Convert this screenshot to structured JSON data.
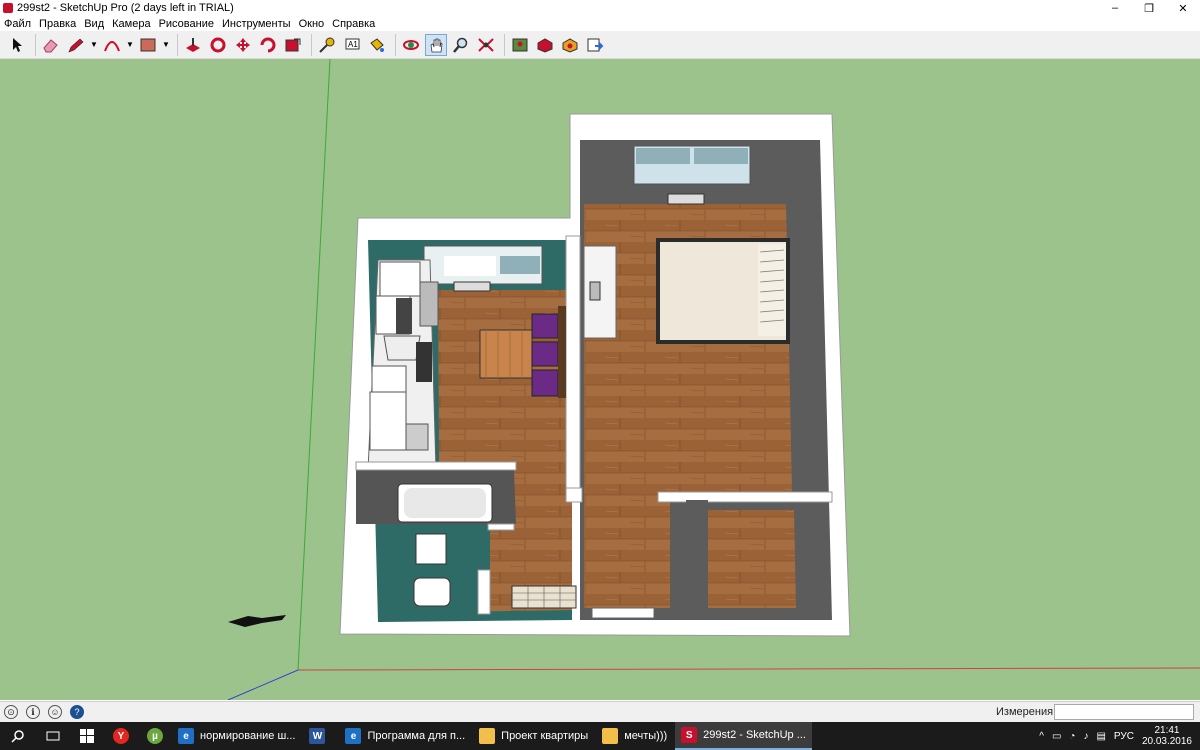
{
  "window": {
    "title": "299st2 - SketchUp Pro (2 days left in TRIAL)",
    "minimize": "–",
    "restore": "❐",
    "close": "✕"
  },
  "menu": [
    "Файл",
    "Правка",
    "Вид",
    "Камера",
    "Рисование",
    "Инструменты",
    "Окно",
    "Справка"
  ],
  "toolbar": {
    "tools": [
      "select-icon",
      "eraser-icon",
      "pencil-icon",
      "arc-icon",
      "rectangle-icon",
      "push-pull-icon",
      "follow-me-icon",
      "move-icon",
      "rotate-icon",
      "scale-icon",
      "tape-measure-icon",
      "text-icon",
      "paint-bucket-icon",
      "orbit-icon",
      "pan-icon",
      "zoom-icon",
      "zoom-extents-icon",
      "add-location-icon",
      "3d-warehouse-icon",
      "extension-warehouse-icon",
      "send-to-layout-icon"
    ],
    "active_tool": "pan-icon"
  },
  "statusbar": {
    "measure_label": "Измерения",
    "icons": [
      "geo-icon",
      "info-icon",
      "user-icon",
      "help-icon"
    ]
  },
  "taskbar": {
    "apps": [
      {
        "name": "Yandex",
        "icon": "Y",
        "color": "#e52620"
      },
      {
        "name": "uTorrent",
        "icon": "µ",
        "color": "#6aa83f"
      }
    ],
    "tasks": [
      {
        "icon": "e",
        "color": "#1f6fc5",
        "label": "нормирование ш...",
        "active": false
      },
      {
        "icon": "W",
        "color": "#2b579a",
        "label": "",
        "active": false
      },
      {
        "icon": "e",
        "color": "#1f6fc5",
        "label": "Программа для п...",
        "active": false
      },
      {
        "icon": "",
        "color": "#f2c04a",
        "label": "Проект квартиры",
        "active": false
      },
      {
        "icon": "",
        "color": "#f2c04a",
        "label": "мечты)))",
        "active": false
      },
      {
        "icon": "S",
        "color": "#c8102e",
        "label": "299st2 - SketchUp ...",
        "active": true
      }
    ],
    "tray": {
      "lang": "РУС",
      "time": "21:41",
      "date": "20.03.2016"
    }
  },
  "colors": {
    "viewport_bg": "#9dc38d",
    "floor": "#a06a3e",
    "wall_top": "#ffffff",
    "wall_inner": "#5c5c5c",
    "kitchen_wall": "#2f6b66",
    "ottoman": "#6a2a86"
  }
}
